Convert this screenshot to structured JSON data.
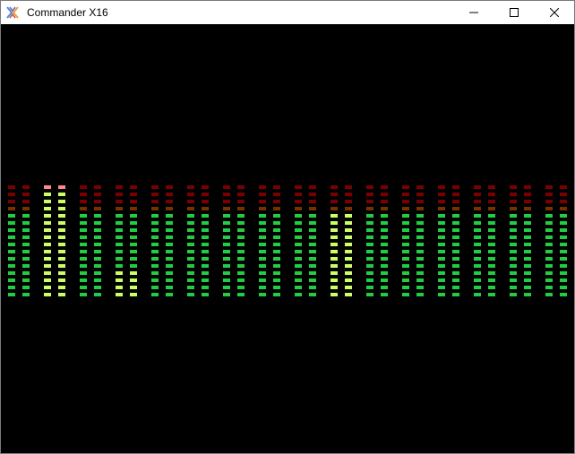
{
  "window": {
    "title": "Commander X16",
    "app_icon": "x16-logo-icon",
    "controls": [
      "minimize-icon",
      "maximize-icon",
      "close-icon"
    ]
  },
  "colors": {
    "off_red": "#7a0000",
    "off_orange": "#7a3000",
    "on_green": "#22cc44",
    "on_lime": "#ccff66",
    "on_pink": "#ff8888",
    "background": "#000000"
  },
  "meters": {
    "segments_per_bar": 16,
    "bars_per_channel": 2,
    "channels": [
      {
        "bars": [
          {
            "level": 12
          },
          {
            "level": 12
          }
        ]
      },
      {
        "bars": [
          {
            "level": 16,
            "peak": 16
          },
          {
            "level": 16,
            "peak": 16
          }
        ]
      },
      {
        "bars": [
          {
            "level": 12
          },
          {
            "level": 12
          }
        ]
      },
      {
        "bars": [
          {
            "level": 12,
            "peak": 4
          },
          {
            "level": 12,
            "peak": 4
          }
        ]
      },
      {
        "bars": [
          {
            "level": 12
          },
          {
            "level": 12
          }
        ]
      },
      {
        "bars": [
          {
            "level": 12
          },
          {
            "level": 12
          }
        ]
      },
      {
        "bars": [
          {
            "level": 12
          },
          {
            "level": 12
          }
        ]
      },
      {
        "bars": [
          {
            "level": 12
          },
          {
            "level": 12
          }
        ]
      },
      {
        "bars": [
          {
            "level": 12
          },
          {
            "level": 12
          }
        ]
      },
      {
        "bars": [
          {
            "level": 12,
            "peak": 12
          },
          {
            "level": 12,
            "peak": 12
          }
        ]
      },
      {
        "bars": [
          {
            "level": 12
          },
          {
            "level": 12
          }
        ]
      },
      {
        "bars": [
          {
            "level": 12
          },
          {
            "level": 12
          }
        ]
      },
      {
        "bars": [
          {
            "level": 12
          },
          {
            "level": 12
          }
        ]
      },
      {
        "bars": [
          {
            "level": 12
          },
          {
            "level": 12
          }
        ]
      },
      {
        "bars": [
          {
            "level": 12
          },
          {
            "level": 12
          }
        ]
      },
      {
        "bars": [
          {
            "level": 12
          },
          {
            "level": 12
          }
        ]
      }
    ]
  }
}
